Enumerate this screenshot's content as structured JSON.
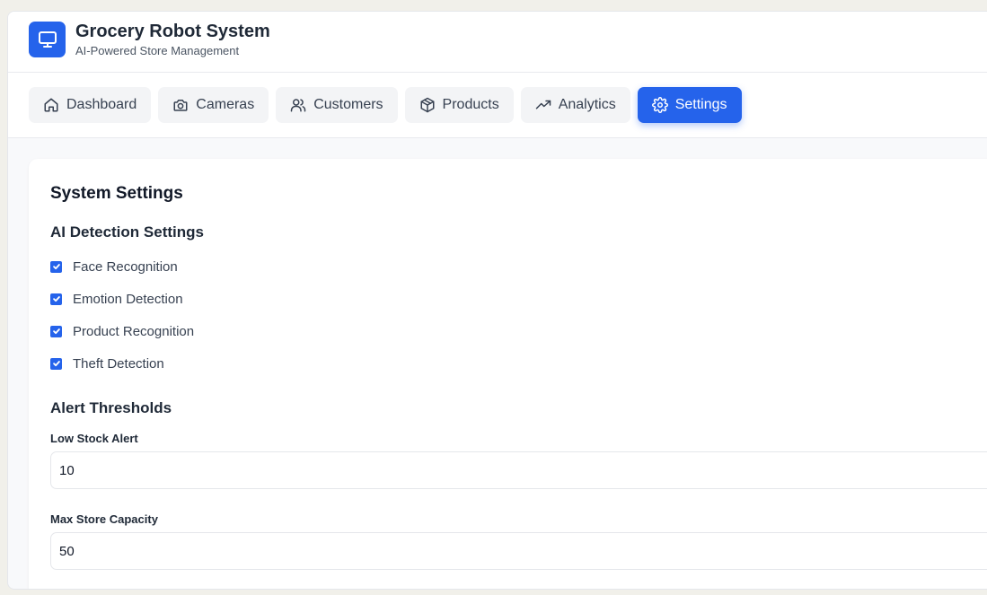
{
  "app": {
    "title": "Grocery Robot System",
    "subtitle": "AI-Powered Store Management",
    "accent_color": "#2563eb",
    "logo_icon": "monitor-icon"
  },
  "nav": {
    "tabs": [
      {
        "label": "Dashboard",
        "icon": "home-icon",
        "active": false
      },
      {
        "label": "Cameras",
        "icon": "camera-icon",
        "active": false
      },
      {
        "label": "Customers",
        "icon": "users-icon",
        "active": false
      },
      {
        "label": "Products",
        "icon": "package-icon",
        "active": false
      },
      {
        "label": "Analytics",
        "icon": "trending-up-icon",
        "active": false
      },
      {
        "label": "Settings",
        "icon": "gear-icon",
        "active": true
      }
    ]
  },
  "settings": {
    "title": "System Settings",
    "ai_section": {
      "title": "AI Detection Settings",
      "options": [
        {
          "label": "Face Recognition",
          "checked": true
        },
        {
          "label": "Emotion Detection",
          "checked": true
        },
        {
          "label": "Product Recognition",
          "checked": true
        },
        {
          "label": "Theft Detection",
          "checked": true
        }
      ]
    },
    "alerts_section": {
      "title": "Alert Thresholds",
      "low_stock": {
        "label": "Low Stock Alert",
        "value": "10"
      },
      "max_capacity": {
        "label": "Max Store Capacity",
        "value": "50"
      }
    }
  }
}
